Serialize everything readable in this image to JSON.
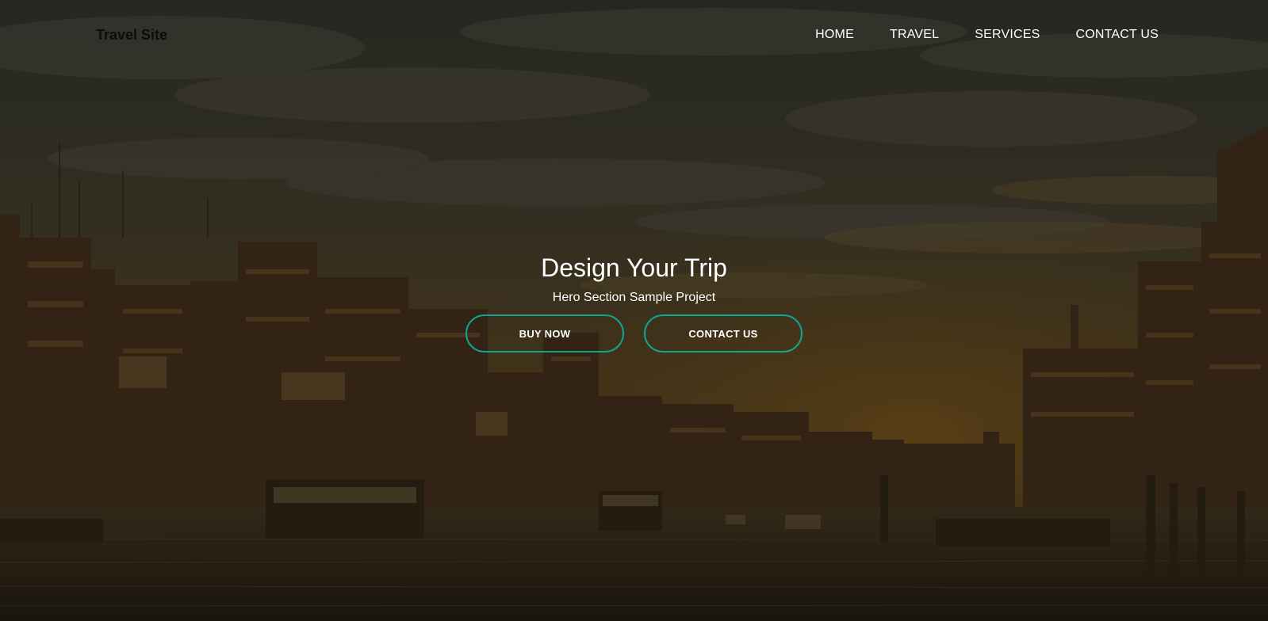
{
  "nav": {
    "logo": "Travel Site",
    "links": [
      "HOME",
      "TRAVEL",
      "SERVICES",
      "CONTACT US"
    ]
  },
  "hero": {
    "title": "Design Your Trip",
    "subtitle": "Hero Section Sample Project",
    "buttons": {
      "primary": "BUY NOW",
      "secondary": "CONTACT US"
    },
    "background": "dusk-venice-grand-canal",
    "accent_color": "#12a58e"
  }
}
